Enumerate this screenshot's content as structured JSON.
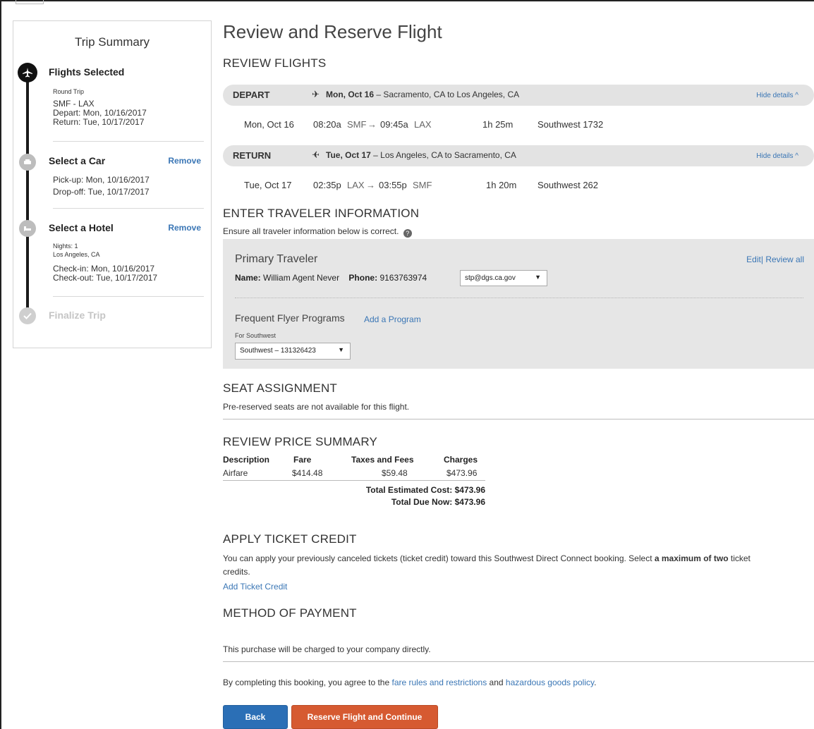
{
  "sidebar": {
    "title": "Trip Summary",
    "steps": [
      {
        "title": "Flights Selected",
        "lines": [
          "Round Trip",
          "SMF - LAX",
          "Depart: Mon, 10/16/2017",
          "Return: Tue, 10/17/2017"
        ]
      },
      {
        "title": "Select a Car",
        "action": "Remove",
        "lines": [
          "Pick-up: Mon, 10/16/2017",
          "Drop-off: Tue, 10/17/2017"
        ]
      },
      {
        "title": "Select a Hotel",
        "action": "Remove",
        "lines": [
          "Nights: 1",
          "Los Angeles, CA",
          "Check-in: Mon, 10/16/2017",
          "Check-out: Tue, 10/17/2017"
        ]
      },
      {
        "title": "Finalize Trip"
      }
    ]
  },
  "page_title": "Review and Reserve Flight",
  "review_flights": {
    "heading": "REVIEW FLIGHTS",
    "legs": [
      {
        "label": "DEPART",
        "date_bold": "Mon, Oct 16",
        "route": " – Sacramento, CA to Los Angeles, CA",
        "hide": "Hide details ^",
        "date": "Mon, Oct 16",
        "dep_time": "08:20a",
        "dep_code": "SMF",
        "arr_time": "09:45a",
        "arr_code": "LAX",
        "duration": "1h 25m",
        "flight": "Southwest 1732"
      },
      {
        "label": "RETURN",
        "date_bold": "Tue, Oct 17",
        "route": " – Los Angeles, CA to Sacramento, CA",
        "hide": "Hide details ^",
        "date": "Tue, Oct 17",
        "dep_time": "02:35p",
        "dep_code": "LAX",
        "arr_time": "03:55p",
        "arr_code": "SMF",
        "duration": "1h 20m",
        "flight": "Southwest 262"
      }
    ]
  },
  "traveler": {
    "heading": "ENTER TRAVELER INFORMATION",
    "subtext": "Ensure all traveler information below is correct.",
    "panel_title": "Primary Traveler",
    "edit": "Edit",
    "review_all": "Review all",
    "name_label": "Name:",
    "name": "William Agent Never",
    "phone_label": "Phone:",
    "phone": "9163763974",
    "email_selected": "stp@dgs.ca.gov",
    "ff_heading": "Frequent Flyer Programs",
    "ff_add": "Add a Program",
    "ff_for": "For Southwest",
    "ff_selected": "Southwest – 131326423"
  },
  "seat": {
    "heading": "SEAT ASSIGNMENT",
    "text": "Pre-reserved seats are not available for this flight."
  },
  "price": {
    "heading": "REVIEW PRICE SUMMARY",
    "columns": [
      "Description",
      "Fare",
      "Taxes and Fees",
      "Charges"
    ],
    "row": [
      "Airfare",
      "$414.48",
      "$59.48",
      "$473.96"
    ],
    "total_estimated": "Total Estimated Cost: $473.96",
    "total_due": "Total Due Now: $473.96"
  },
  "ticket_credit": {
    "heading": "APPLY TICKET CREDIT",
    "text_a": "You can apply your previously canceled tickets (ticket credit) toward this Southwest Direct Connect booking. Select ",
    "text_bold": "a maximum of two",
    "text_b": " ticket",
    "text_c": "credits.",
    "link": "Add Ticket Credit"
  },
  "payment": {
    "heading": "METHOD OF PAYMENT",
    "text": "This purchase will be charged to your company directly."
  },
  "agreement": {
    "prefix": "By completing this booking, you agree to the ",
    "link1": "fare rules and restrictions",
    "mid": " and ",
    "link2": "hazardous goods policy",
    "suffix": "."
  },
  "buttons": {
    "back": "Back",
    "reserve": "Reserve Flight and Continue"
  }
}
